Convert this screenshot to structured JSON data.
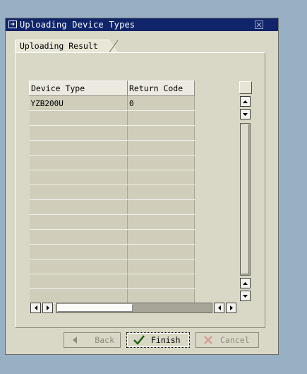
{
  "window": {
    "title": "Uploading Device Types"
  },
  "tab": {
    "label": "Uploading Result"
  },
  "table": {
    "columns": [
      "Device Type",
      "Return Code"
    ],
    "rows": [
      [
        "YZB200U",
        "0"
      ],
      [
        "",
        ""
      ],
      [
        "",
        ""
      ],
      [
        "",
        ""
      ],
      [
        "",
        ""
      ],
      [
        "",
        ""
      ],
      [
        "",
        ""
      ],
      [
        "",
        ""
      ],
      [
        "",
        ""
      ],
      [
        "",
        ""
      ],
      [
        "",
        ""
      ],
      [
        "",
        ""
      ],
      [
        "",
        ""
      ],
      [
        "",
        ""
      ]
    ]
  },
  "buttons": {
    "back": "Back",
    "finish": "Finish",
    "cancel": "Cancel"
  },
  "icons": {
    "window": "window-icon",
    "close": "close-icon",
    "finish": "checkmark-icon",
    "back": "back-arrow-icon",
    "cancel": "cancel-x-icon"
  }
}
